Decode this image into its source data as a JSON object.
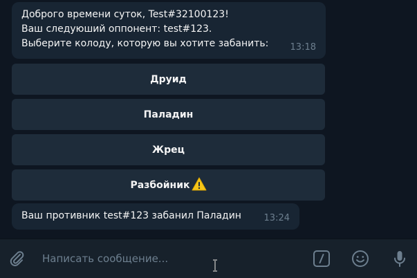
{
  "messages": [
    {
      "lines": [
        "Доброго времени суток, Test#32100123!",
        "Ваш следуюший оппонент: test#123.",
        "Выберите колоду, которую вы хотите забанить:"
      ],
      "time": "13:18"
    },
    {
      "text": "Ваш противник test#123 забанил Паладин",
      "time": "13:24"
    }
  ],
  "keyboard": {
    "buttons": [
      {
        "label": "Друид"
      },
      {
        "label": "Паладин"
      },
      {
        "label": "Жрец"
      },
      {
        "label": "Разбойник",
        "badge_icon": "warning-icon"
      }
    ]
  },
  "composer": {
    "placeholder": "Написать сообщение...",
    "icons": [
      "paperclip-icon",
      "slash-command-icon",
      "emoji-icon",
      "microphone-icon"
    ]
  },
  "colors": {
    "background": "#0e1621",
    "bubble": "#182533",
    "keyboard_button": "#1e2c3a",
    "input_bar": "#17212b",
    "warning": "#f5c518"
  }
}
